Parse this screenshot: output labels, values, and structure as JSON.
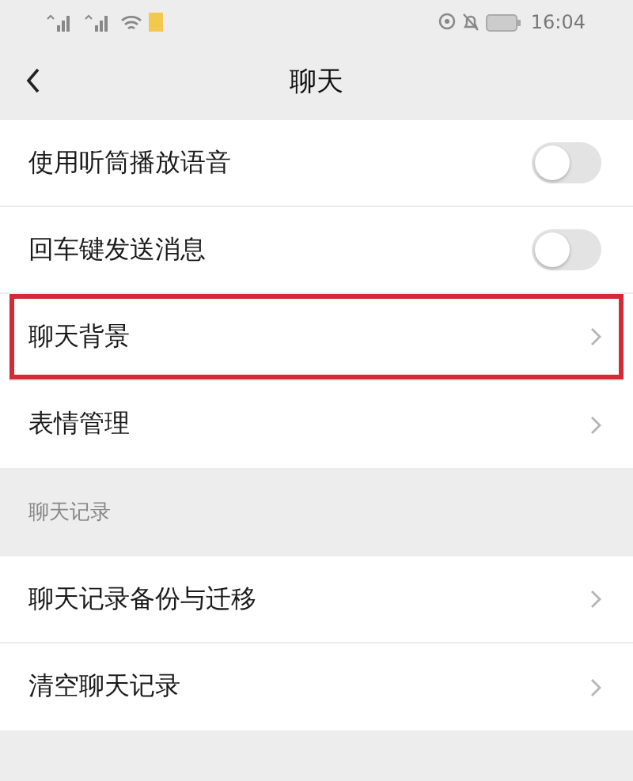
{
  "status_bar": {
    "time": "16:04"
  },
  "header": {
    "title": "聊天"
  },
  "sections": [
    {
      "items": [
        {
          "label": "使用听筒播放语音",
          "kind": "toggle",
          "on": false,
          "highlighted": false
        },
        {
          "label": "回车键发送消息",
          "kind": "toggle",
          "on": false,
          "highlighted": false
        },
        {
          "label": "聊天背景",
          "kind": "link",
          "highlighted": true
        },
        {
          "label": "表情管理",
          "kind": "link",
          "highlighted": false
        }
      ]
    },
    {
      "title": "聊天记录",
      "items": [
        {
          "label": "聊天记录备份与迁移",
          "kind": "link",
          "highlighted": false
        },
        {
          "label": "清空聊天记录",
          "kind": "link",
          "highlighted": false
        }
      ]
    }
  ]
}
